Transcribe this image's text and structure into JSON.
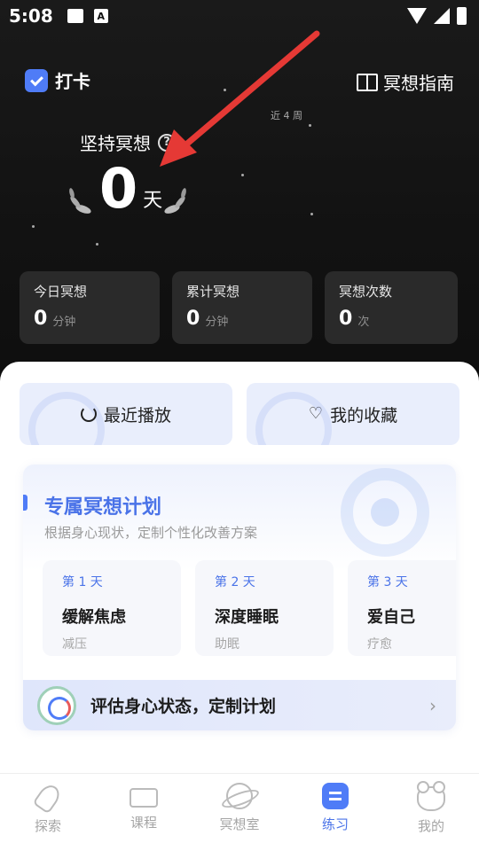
{
  "status": {
    "time": "5:08",
    "a_icon_text": "A"
  },
  "header": {
    "checkin_label": "打卡",
    "guide_label": "冥想指南",
    "recent_weeks": "近 4 周"
  },
  "streak": {
    "title": "坚持冥想",
    "help": "?",
    "days": "0",
    "unit": "天"
  },
  "stats": [
    {
      "title": "今日冥想",
      "value": "0",
      "unit": "分钟"
    },
    {
      "title": "累计冥想",
      "value": "0",
      "unit": "分钟"
    },
    {
      "title": "冥想次数",
      "value": "0",
      "unit": "次"
    }
  ],
  "quick": {
    "recent": "最近播放",
    "favorites": "我的收藏"
  },
  "plan": {
    "title": "专属冥想计划",
    "subtitle": "根据身心现状，定制个性化改善方案",
    "days": [
      {
        "label": "第 1 天",
        "name": "缓解焦虑",
        "tag": "减压"
      },
      {
        "label": "第 2 天",
        "name": "深度睡眠",
        "tag": "助眠"
      },
      {
        "label": "第 3 天",
        "name": "爱自己",
        "tag": "疗愈"
      }
    ],
    "assess": "评估身心状态，定制计划",
    "assess_chevron": "›"
  },
  "tabs": [
    {
      "label": "探索"
    },
    {
      "label": "课程"
    },
    {
      "label": "冥想室"
    },
    {
      "label": "练习"
    },
    {
      "label": "我的"
    }
  ],
  "colors": {
    "accent": "#4f7cf7",
    "arrow": "#e53935",
    "hero_bg": "#141414"
  }
}
